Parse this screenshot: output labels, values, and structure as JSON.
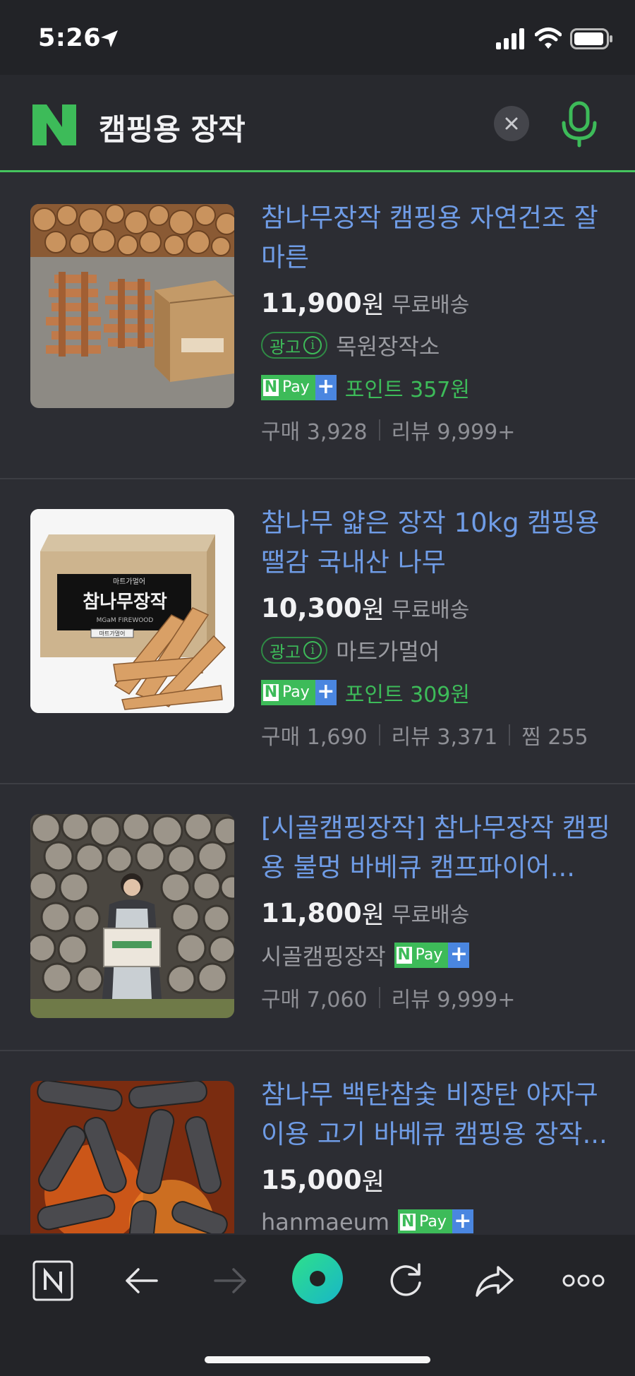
{
  "status_bar": {
    "time": "5:26"
  },
  "search": {
    "query": "캠핑용 장작"
  },
  "products": [
    {
      "title": "참나무장작 캠핑용 자연건조 잘 마른",
      "price": "11,900",
      "currency": "원",
      "shipping": "무료배송",
      "ad_label": "광고",
      "seller": "목원장작소",
      "pay_label": "Pay",
      "points": "포인트 357원",
      "stats": [
        "구매 3,928",
        "리뷰 9,999+"
      ]
    },
    {
      "title": "참나무 얇은 장작 10kg 캠핑용 땔감 국내산 나무",
      "price": "10,300",
      "currency": "원",
      "shipping": "무료배송",
      "ad_label": "광고",
      "seller": "마트가멀어",
      "pay_label": "Pay",
      "points": "포인트 309원",
      "stats": [
        "구매 1,690",
        "리뷰 3,371",
        "찜 255"
      ],
      "box_small_text": "마트가멀어",
      "box_title": "참나무장작",
      "box_sub": "MGaM FIREWOOD",
      "box_tag": "마트가멀어"
    },
    {
      "title": "[시골캠핑장작] 참나무장작 캠핑용 불멍 바베큐 캠프파이어...",
      "price": "11,800",
      "currency": "원",
      "shipping": "무료배송",
      "seller": "시골캠핑장작",
      "pay_label": "Pay",
      "stats": [
        "구매 7,060",
        "리뷰 9,999+"
      ]
    },
    {
      "title": "참나무 백탄참숯 비장탄 야자구 이용 고기 바베큐 캠핑용 장작...",
      "price": "15,000",
      "currency": "원",
      "seller": "hanmaeum",
      "pay_label": "Pay"
    }
  ],
  "colors": {
    "accent_green": "#3dbb59",
    "link_blue": "#6f9ce6",
    "background": "#2c2d33"
  },
  "toolbar": {
    "icons": [
      "naver-home-icon",
      "back-arrow-icon",
      "forward-arrow-icon",
      "green-dot-icon",
      "reload-icon",
      "share-icon",
      "more-icon"
    ]
  }
}
